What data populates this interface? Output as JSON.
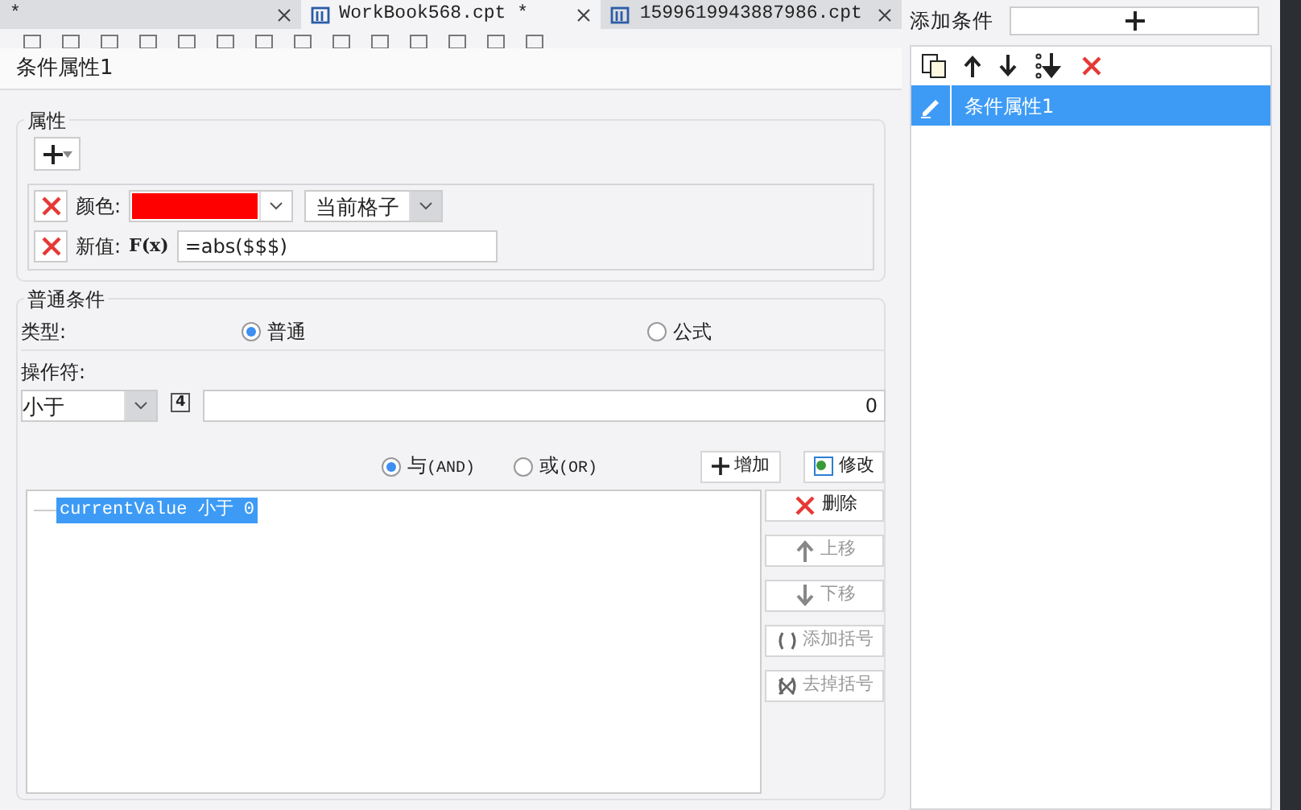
{
  "background_tabs": [
    {
      "label": "*",
      "selected": false
    },
    {
      "label": "WorkBook568.cpt *",
      "selected": true
    },
    {
      "label": "1599619943887986.cpt",
      "selected": false
    }
  ],
  "dialog": {
    "title": "条件属性1"
  },
  "attributes": {
    "legend": "属性",
    "rows": [
      {
        "kind": "color",
        "label": "颜色:",
        "color": "#ff0000",
        "scope": "当前格子"
      },
      {
        "kind": "formula",
        "label": "新值:",
        "icon_text": "F(x)",
        "value": "=abs($$$)"
      }
    ]
  },
  "condition": {
    "legend": "普通条件",
    "type_label": "类型:",
    "types": [
      {
        "label": "普通",
        "selected": true
      },
      {
        "label": "公式",
        "selected": false
      }
    ],
    "operator_label": "操作符:",
    "operator": "小于",
    "operand_icon": "4",
    "operand": "0",
    "joins": [
      {
        "label": "与",
        "suffix": "(AND)",
        "selected": true
      },
      {
        "label": "或",
        "suffix": "(OR)",
        "selected": false
      }
    ],
    "add_button": "增加",
    "modify_button": "修改",
    "items": [
      {
        "text": "currentValue 小于 0",
        "selected": true
      }
    ],
    "actions": [
      {
        "kind": "delete",
        "label": "删除",
        "disabled": false
      },
      {
        "kind": "up",
        "label": "上移",
        "disabled": true
      },
      {
        "kind": "down",
        "label": "下移",
        "disabled": true
      },
      {
        "kind": "add-brackets",
        "label": "添加括号",
        "disabled": true
      },
      {
        "kind": "remove-brackets",
        "label": "去掉括号",
        "disabled": true
      }
    ]
  },
  "conditions_panel": {
    "label": "添加条件",
    "items": [
      {
        "label": "条件属性1",
        "selected": true
      }
    ]
  }
}
